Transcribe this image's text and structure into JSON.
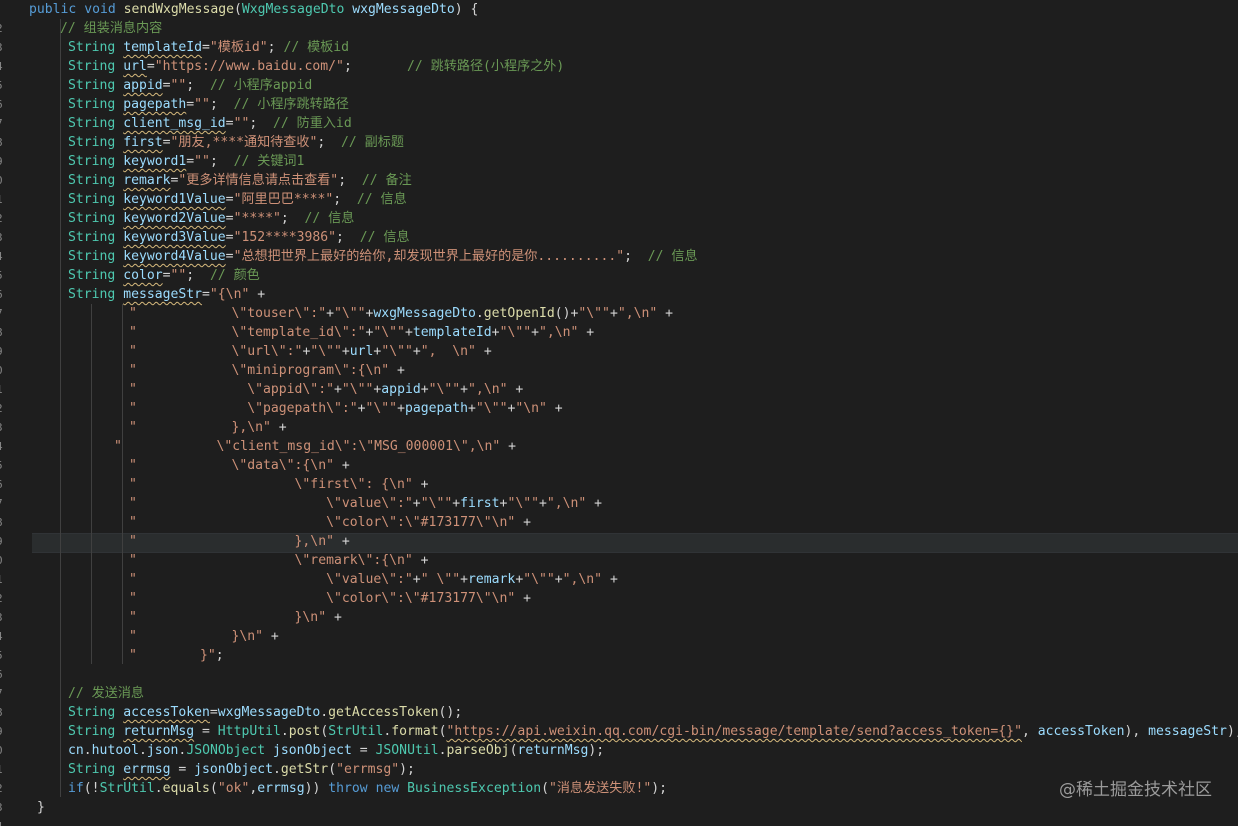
{
  "editor": {
    "gutter_fragments": [
      "2",
      "3",
      "4",
      "5",
      "6",
      "7",
      "8",
      "9",
      "0",
      "1",
      "2",
      "3",
      "4",
      "5",
      "6",
      "7",
      "8",
      "9",
      "0",
      "1",
      "2",
      "3",
      "4",
      "5",
      "6",
      "7",
      "8",
      "9",
      "0",
      "1",
      "2",
      "3",
      "4",
      "5",
      "6",
      "7",
      "8",
      "9",
      "0",
      "1",
      "2",
      "3",
      "4"
    ],
    "lines": [
      [
        [
          "kw",
          "public "
        ],
        [
          "kw",
          "void "
        ],
        [
          "fn",
          "sendWxgMessage"
        ],
        [
          "",
          "("
        ],
        [
          "ty",
          "WxgMessageDto "
        ],
        [
          "vr",
          "wxgMessageDto"
        ],
        [
          "",
          ") {"
        ]
      ],
      [
        [
          "cm",
          "// 组装消息内容"
        ]
      ],
      [
        [
          "ty",
          "String "
        ],
        [
          "vr",
          "templateId",
          "wv"
        ],
        [
          "",
          "="
        ],
        [
          "st",
          "\"模板id\""
        ],
        [
          "",
          "; "
        ],
        [
          "cm",
          "// 模板id"
        ]
      ],
      [
        [
          "ty",
          "String "
        ],
        [
          "vr",
          "url",
          "wv"
        ],
        [
          "",
          "="
        ],
        [
          "st",
          "\"https://www.baidu.com/\""
        ],
        [
          "",
          ";       "
        ],
        [
          "cm",
          "// 跳转路径(小程序之外)"
        ]
      ],
      [
        [
          "ty",
          "String "
        ],
        [
          "vr",
          "appid",
          "wv"
        ],
        [
          "",
          "="
        ],
        [
          "st",
          "\"\""
        ],
        [
          "",
          ";  "
        ],
        [
          "cm",
          "// 小程序appid"
        ]
      ],
      [
        [
          "ty",
          "String "
        ],
        [
          "vr",
          "pagepath",
          "wv"
        ],
        [
          "",
          "="
        ],
        [
          "st",
          "\"\""
        ],
        [
          "",
          ";  "
        ],
        [
          "cm",
          "// 小程序跳转路径"
        ]
      ],
      [
        [
          "ty",
          "String "
        ],
        [
          "vr",
          "client_msg_id",
          "wv"
        ],
        [
          "",
          "="
        ],
        [
          "st",
          "\"\""
        ],
        [
          "",
          ";  "
        ],
        [
          "cm",
          "// 防重入id"
        ]
      ],
      [
        [
          "ty",
          "String "
        ],
        [
          "vr",
          "first",
          "wv"
        ],
        [
          "",
          "="
        ],
        [
          "st",
          "\"朋友,****通知待查收\""
        ],
        [
          "",
          ";  "
        ],
        [
          "cm",
          "// 副标题"
        ]
      ],
      [
        [
          "ty",
          "String "
        ],
        [
          "vr",
          "keyword1",
          "wv"
        ],
        [
          "",
          "="
        ],
        [
          "st",
          "\"\""
        ],
        [
          "",
          ";  "
        ],
        [
          "cm",
          "// 关键词1"
        ]
      ],
      [
        [
          "ty",
          "String "
        ],
        [
          "vr",
          "remark",
          "wv"
        ],
        [
          "",
          "="
        ],
        [
          "st",
          "\"更多详情信息请点击查看\""
        ],
        [
          "",
          ";  "
        ],
        [
          "cm",
          "// 备注"
        ]
      ],
      [
        [
          "ty",
          "String "
        ],
        [
          "vr",
          "keyword1Value",
          "wv"
        ],
        [
          "",
          "="
        ],
        [
          "st",
          "\"阿里巴巴****\""
        ],
        [
          "",
          ";  "
        ],
        [
          "cm",
          "// 信息"
        ]
      ],
      [
        [
          "ty",
          "String "
        ],
        [
          "vr",
          "keyword2Value",
          "wv"
        ],
        [
          "",
          "="
        ],
        [
          "st",
          "\"****\""
        ],
        [
          "",
          ";  "
        ],
        [
          "cm",
          "// 信息"
        ]
      ],
      [
        [
          "ty",
          "String "
        ],
        [
          "vr",
          "keyword3Value",
          "wv"
        ],
        [
          "",
          "="
        ],
        [
          "st",
          "\"152****3986\""
        ],
        [
          "",
          ";  "
        ],
        [
          "cm",
          "// 信息"
        ]
      ],
      [
        [
          "ty",
          "String "
        ],
        [
          "vr",
          "keyword4Value",
          "wv"
        ],
        [
          "",
          "="
        ],
        [
          "st",
          "\"总想把世界上最好的给你,却发现世界上最好的是你..........\""
        ],
        [
          "",
          ";  "
        ],
        [
          "cm",
          "// 信息"
        ]
      ],
      [
        [
          "ty",
          "String "
        ],
        [
          "vr",
          "color",
          "wv"
        ],
        [
          "",
          "="
        ],
        [
          "st",
          "\"\""
        ],
        [
          "",
          ";  "
        ],
        [
          "cm",
          "// 颜色"
        ]
      ],
      [
        [
          "ty",
          "String "
        ],
        [
          "vr",
          "messageStr",
          "wv"
        ],
        [
          "",
          "="
        ],
        [
          "st",
          "\"{\\n\""
        ],
        [
          "",
          " +"
        ]
      ],
      [
        [
          "st",
          "\"            \\\"touser\\\":\""
        ],
        [
          "",
          "+"
        ],
        [
          "st",
          "\"\\\"\""
        ],
        [
          "",
          "+"
        ],
        [
          "vr",
          "wxgMessageDto"
        ],
        [
          "",
          "."
        ],
        [
          "fn",
          "getOpenId"
        ],
        [
          "",
          "()+"
        ],
        [
          "st",
          "\"\\\"\""
        ],
        [
          "",
          "+"
        ],
        [
          "st",
          "\",\\n\""
        ],
        [
          "",
          " +"
        ]
      ],
      [
        [
          "st",
          "\"            \\\"template_id\\\":\""
        ],
        [
          "",
          "+"
        ],
        [
          "st",
          "\"\\\"\""
        ],
        [
          "",
          "+"
        ],
        [
          "vr",
          "templateId"
        ],
        [
          "",
          "+"
        ],
        [
          "st",
          "\"\\\"\""
        ],
        [
          "",
          "+"
        ],
        [
          "st",
          "\",\\n\""
        ],
        [
          "",
          " +"
        ]
      ],
      [
        [
          "st",
          "\"            \\\"url\\\":\""
        ],
        [
          "",
          "+"
        ],
        [
          "st",
          "\"\\\"\""
        ],
        [
          "",
          "+"
        ],
        [
          "vr",
          "url"
        ],
        [
          "",
          "+"
        ],
        [
          "st",
          "\"\\\"\""
        ],
        [
          "",
          "+"
        ],
        [
          "st",
          "\",  \\n\""
        ],
        [
          "",
          " +"
        ]
      ],
      [
        [
          "st",
          "\"            \\\"miniprogram\\\":{\\n\""
        ],
        [
          "",
          " +"
        ]
      ],
      [
        [
          "st",
          "\"              \\\"appid\\\":\""
        ],
        [
          "",
          "+"
        ],
        [
          "st",
          "\"\\\"\""
        ],
        [
          "",
          "+"
        ],
        [
          "vr",
          "appid"
        ],
        [
          "",
          "+"
        ],
        [
          "st",
          "\"\\\"\""
        ],
        [
          "",
          "+"
        ],
        [
          "st",
          "\",\\n\""
        ],
        [
          "",
          " +"
        ]
      ],
      [
        [
          "st",
          "\"              \\\"pagepath\\\":\""
        ],
        [
          "",
          "+"
        ],
        [
          "st",
          "\"\\\"\""
        ],
        [
          "",
          "+"
        ],
        [
          "vr",
          "pagepath"
        ],
        [
          "",
          "+"
        ],
        [
          "st",
          "\"\\\"\""
        ],
        [
          "",
          "+"
        ],
        [
          "st",
          "\"\\n\""
        ],
        [
          "",
          " +"
        ]
      ],
      [
        [
          "st",
          "\"            },\\n\""
        ],
        [
          "",
          " +"
        ]
      ],
      [
        [
          "st",
          "\"            \\\"client_msg_id\\\":\\\"MSG_000001\\\",\\n\""
        ],
        [
          "",
          " +"
        ]
      ],
      [
        [
          "st",
          "\"            \\\"data\\\":{\\n\""
        ],
        [
          "",
          " +"
        ]
      ],
      [
        [
          "st",
          "\"                    \\\"first\\\": {\\n\""
        ],
        [
          "",
          " +"
        ]
      ],
      [
        [
          "st",
          "\"                        \\\"value\\\":\""
        ],
        [
          "",
          "+"
        ],
        [
          "st",
          "\"\\\"\""
        ],
        [
          "",
          "+"
        ],
        [
          "vr",
          "first"
        ],
        [
          "",
          "+"
        ],
        [
          "st",
          "\"\\\"\""
        ],
        [
          "",
          "+"
        ],
        [
          "st",
          "\",\\n\""
        ],
        [
          "",
          " +"
        ]
      ],
      [
        [
          "st",
          "\"                        \\\"color\\\":\\\"#173177\\\"\\n\""
        ],
        [
          "",
          " +"
        ]
      ],
      [
        [
          "st",
          "\"                    },\\n\""
        ],
        [
          "",
          " +"
        ]
      ],
      [
        [
          "st",
          "\"                    \\\"remark\\\":{\\n\""
        ],
        [
          "",
          " +"
        ]
      ],
      [
        [
          "st",
          "\"                        \\\"value\\\":\""
        ],
        [
          "",
          "+"
        ],
        [
          "st",
          "\" \\\"\""
        ],
        [
          "",
          "+"
        ],
        [
          "vr",
          "remark"
        ],
        [
          "",
          "+"
        ],
        [
          "st",
          "\"\\\"\""
        ],
        [
          "",
          "+"
        ],
        [
          "st",
          "\",\\n\""
        ],
        [
          "",
          " +"
        ]
      ],
      [
        [
          "st",
          "\"                        \\\"color\\\":\\\"#173177\\\"\\n\""
        ],
        [
          "",
          " +"
        ]
      ],
      [
        [
          "st",
          "\"                    }\\n\""
        ],
        [
          "",
          " +"
        ]
      ],
      [
        [
          "st",
          "\"            }\\n\""
        ],
        [
          "",
          " +"
        ]
      ],
      [
        [
          "st",
          "\"        }\""
        ],
        [
          "",
          ";"
        ]
      ],
      [],
      [
        [
          "cm",
          "// 发送消息"
        ]
      ],
      [
        [
          "ty",
          "String "
        ],
        [
          "vr",
          "accessToken",
          "wv"
        ],
        [
          "",
          "="
        ],
        [
          "vr",
          "wxgMessageDto"
        ],
        [
          "",
          "."
        ],
        [
          "fn",
          "getAccessToken"
        ],
        [
          "",
          "();"
        ]
      ],
      [
        [
          "ty",
          "String "
        ],
        [
          "vr",
          "returnMsg",
          "wv"
        ],
        [
          "",
          " = "
        ],
        [
          "ty",
          "HttpUtil"
        ],
        [
          "",
          "."
        ],
        [
          "fn",
          "post"
        ],
        [
          "",
          "("
        ],
        [
          "ty",
          "StrUtil"
        ],
        [
          "",
          "."
        ],
        [
          "fn",
          "format"
        ],
        [
          "",
          "("
        ],
        [
          "st",
          "\"https://api.weixin.qq.com/cgi-bin/message/template/send?access_token={}\"",
          "wv"
        ],
        [
          "",
          ", "
        ],
        [
          "vr",
          "accessToken"
        ],
        [
          "",
          "), "
        ],
        [
          "vr",
          "messageStr"
        ],
        [
          "",
          ");"
        ]
      ],
      [
        [
          "vr",
          "cn"
        ],
        [
          "",
          "."
        ],
        [
          "vr",
          "hutool"
        ],
        [
          "",
          "."
        ],
        [
          "vr",
          "json"
        ],
        [
          "",
          "."
        ],
        [
          "ty",
          "JSONObject "
        ],
        [
          "vr",
          "jsonObject"
        ],
        [
          "",
          " = "
        ],
        [
          "ty",
          "JSONUtil"
        ],
        [
          "",
          "."
        ],
        [
          "fn",
          "parseObj"
        ],
        [
          "",
          "("
        ],
        [
          "vr",
          "returnMsg"
        ],
        [
          "",
          ");"
        ]
      ],
      [
        [
          "ty",
          "String "
        ],
        [
          "vr",
          "errmsg",
          "wv"
        ],
        [
          "",
          " = "
        ],
        [
          "vr",
          "jsonObject"
        ],
        [
          "",
          "."
        ],
        [
          "fn",
          "getStr"
        ],
        [
          "",
          "("
        ],
        [
          "st",
          "\"errmsg\""
        ],
        [
          "",
          ");"
        ]
      ],
      [
        [
          "kw",
          "if"
        ],
        [
          "",
          "(!"
        ],
        [
          "ty",
          "StrUtil"
        ],
        [
          "",
          "."
        ],
        [
          "fn",
          "equals"
        ],
        [
          "",
          "("
        ],
        [
          "st",
          "\"ok\""
        ],
        [
          "",
          ","
        ],
        [
          "vr",
          "errmsg"
        ],
        [
          "",
          "))"
        ],
        [
          "kw",
          " throw "
        ],
        [
          "kw",
          "new "
        ],
        [
          "ty",
          "BusinessException"
        ],
        [
          "",
          "("
        ],
        [
          "st",
          "\"消息发送失败!\""
        ],
        [
          "",
          ");"
        ]
      ],
      [
        [
          "",
          "}"
        ]
      ]
    ]
  },
  "watermark": "@稀土掘金技术社区"
}
